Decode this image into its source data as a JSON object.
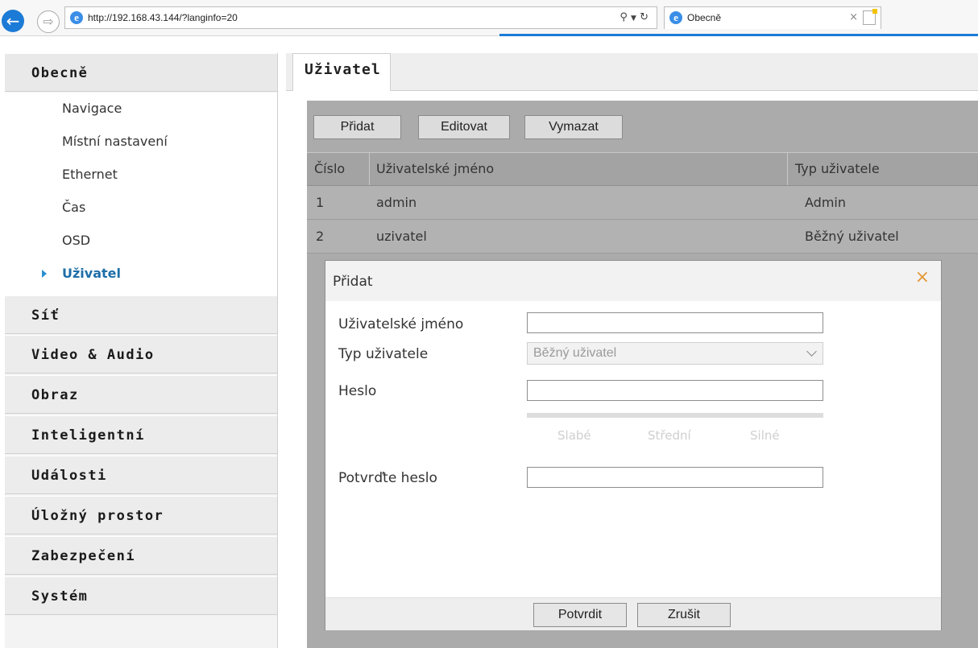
{
  "browser": {
    "url": "http://192.168.43.144/?langinfo=20",
    "tab_title": "Obecně",
    "search_icon": "search-icon",
    "refresh_icon": "refresh-icon"
  },
  "sidebar": {
    "groups": [
      {
        "label": "Obecně",
        "expanded": true,
        "items": [
          {
            "label": "Navigace"
          },
          {
            "label": "Místní nastavení"
          },
          {
            "label": "Ethernet"
          },
          {
            "label": "Čas"
          },
          {
            "label": "OSD"
          },
          {
            "label": "Uživatel",
            "active": true
          }
        ]
      },
      {
        "label": "Síť"
      },
      {
        "label": "Video & Audio"
      },
      {
        "label": "Obraz"
      },
      {
        "label": "Inteligentní"
      },
      {
        "label": "Události"
      },
      {
        "label": "Úložný prostor"
      },
      {
        "label": "Zabezpečení"
      },
      {
        "label": "Systém"
      }
    ]
  },
  "main": {
    "tab_label": "Uživatel",
    "toolbar": {
      "add": "Přidat",
      "edit": "Editovat",
      "delete": "Vymazat"
    },
    "table": {
      "headers": [
        "Číslo",
        "Uživatelské jméno",
        "Typ uživatele"
      ],
      "rows": [
        [
          "1",
          "admin",
          "Admin"
        ],
        [
          "2",
          "uzivatel",
          "Běžný uživatel"
        ]
      ]
    }
  },
  "dialog": {
    "title": "Přidat",
    "close_icon": "close-icon",
    "fields": {
      "username_label": "Uživatelské jméno",
      "username_value": "",
      "user_type_label": "Typ uživatele",
      "user_type_value": "Běžný uživatel",
      "password_label": "Heslo",
      "password_value": "",
      "confirm_label": "Potvrďte heslo",
      "confirm_value": ""
    },
    "strength": {
      "weak": "Slabé",
      "medium": "Střední",
      "strong": "Silné"
    },
    "confirm_button": "Potvrdit",
    "cancel_button": "Zrušit"
  },
  "colors": {
    "accent": "#1e6fa8",
    "close_icon": "#e39a3a",
    "table_background": "#ababab"
  }
}
